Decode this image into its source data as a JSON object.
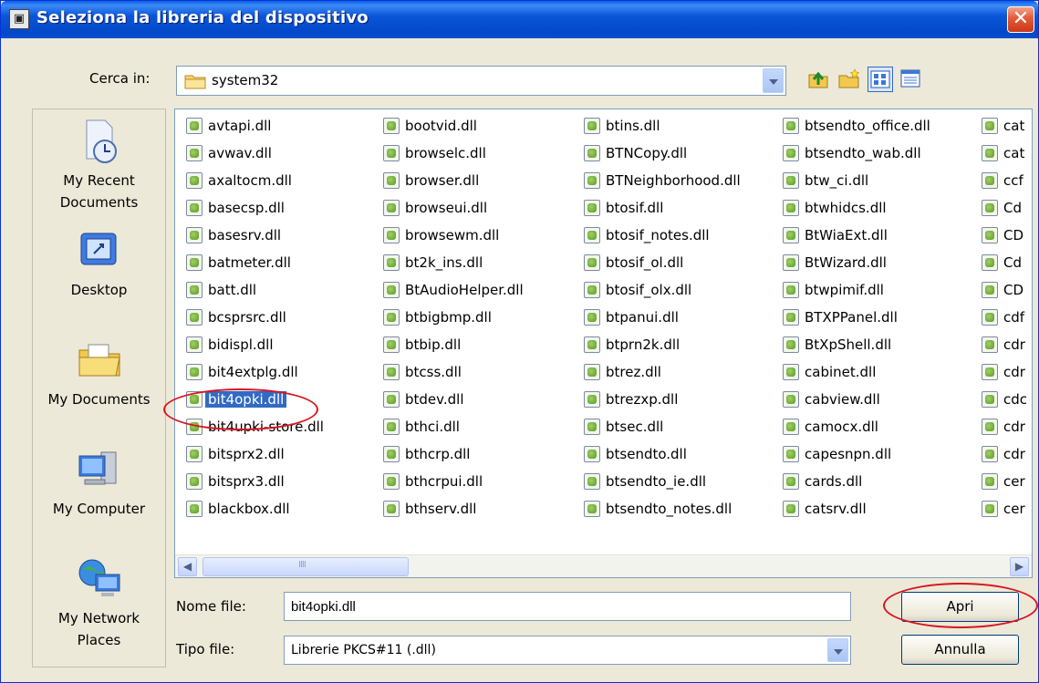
{
  "window": {
    "title": "Seleziona la libreria del dispositivo",
    "close_glyph": "✕"
  },
  "lookin": {
    "label": "Cerca in:",
    "value": "system32"
  },
  "toolbar_icons": [
    "up-folder-icon",
    "new-folder-icon",
    "view-list-icon",
    "view-details-icon"
  ],
  "places": [
    {
      "label": "My Recent\nDocuments",
      "icon": "recent-documents-icon"
    },
    {
      "label": "Desktop",
      "icon": "desktop-icon"
    },
    {
      "label": "My Documents",
      "icon": "my-documents-icon"
    },
    {
      "label": "My Computer",
      "icon": "my-computer-icon"
    },
    {
      "label": "My Network\nPlaces",
      "icon": "network-places-icon"
    }
  ],
  "files": {
    "columns": [
      [
        "avtapi.dll",
        "avwav.dll",
        "axaltocm.dll",
        "basecsp.dll",
        "basesrv.dll",
        "batmeter.dll",
        "batt.dll",
        "bcsprsrc.dll",
        "bidispl.dll",
        "bit4extplg.dll",
        "bit4opki.dll",
        "bit4upki-store.dll",
        "bitsprx2.dll",
        "bitsprx3.dll",
        "blackbox.dll"
      ],
      [
        "bootvid.dll",
        "browselc.dll",
        "browser.dll",
        "browseui.dll",
        "browsewm.dll",
        "bt2k_ins.dll",
        "BtAudioHelper.dll",
        "btbigbmp.dll",
        "btbip.dll",
        "btcss.dll",
        "btdev.dll",
        "bthci.dll",
        "bthcrp.dll",
        "bthcrpui.dll",
        "bthserv.dll"
      ],
      [
        "btins.dll",
        "BTNCopy.dll",
        "BTNeighborhood.dll",
        "btosif.dll",
        "btosif_notes.dll",
        "btosif_ol.dll",
        "btosif_olx.dll",
        "btpanui.dll",
        "btprn2k.dll",
        "btrez.dll",
        "btrezxp.dll",
        "btsec.dll",
        "btsendto.dll",
        "btsendto_ie.dll",
        "btsendto_notes.dll"
      ],
      [
        "btsendto_office.dll",
        "btsendto_wab.dll",
        "btw_ci.dll",
        "btwhidcs.dll",
        "BtWiaExt.dll",
        "BtWizard.dll",
        "btwpimif.dll",
        "BTXPPanel.dll",
        "BtXpShell.dll",
        "cabinet.dll",
        "cabview.dll",
        "camocx.dll",
        "capesnpn.dll",
        "cards.dll",
        "catsrv.dll"
      ],
      [
        "cat",
        "cat",
        "ccf",
        "Cd",
        "CD",
        "Cd",
        "CD",
        "cdf",
        "cdr",
        "cdr",
        "cdc",
        "cdr",
        "cdr",
        "cer",
        "cer"
      ]
    ],
    "selected": "bit4opki.dll"
  },
  "filename": {
    "label": "Nome file:",
    "value": "bit4opki.dll"
  },
  "filetype": {
    "label": "Tipo file:",
    "value": "Librerie PKCS#11 (.dll)"
  },
  "buttons": {
    "open": "Apri",
    "cancel": "Annulla"
  },
  "scrollbar": {
    "left": "◀",
    "right": "▶"
  }
}
